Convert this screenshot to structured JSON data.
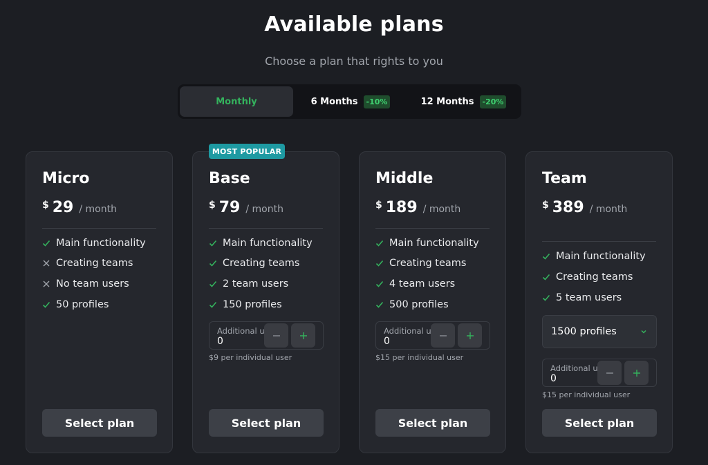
{
  "header": {
    "title": "Available plans",
    "subtitle": "Choose a plan that rights to you"
  },
  "billing": {
    "options": [
      {
        "label": "Monthly",
        "discount": "",
        "active": true
      },
      {
        "label": "6 Months",
        "discount": "-10%",
        "active": false
      },
      {
        "label": "12 Months",
        "discount": "-20%",
        "active": false
      }
    ]
  },
  "badge": "MOST POPULAR",
  "plans": [
    {
      "name": "Micro",
      "currency": "$",
      "price": "29",
      "period": "/ month",
      "features": [
        {
          "text": "Main functionality",
          "included": true
        },
        {
          "text": "Creating teams",
          "included": false
        },
        {
          "text": "No team users",
          "included": false
        },
        {
          "text": "50 profiles",
          "included": true
        }
      ],
      "button": "Select plan"
    },
    {
      "name": "Base",
      "currency": "$",
      "price": "79",
      "period": "/ month",
      "features": [
        {
          "text": "Main functionality",
          "included": true
        },
        {
          "text": "Creating teams",
          "included": true
        },
        {
          "text": "2 team users",
          "included": true
        },
        {
          "text": "150 profiles",
          "included": true
        }
      ],
      "additional": {
        "label": "Additional users",
        "value": "0",
        "note": "$9 per individual user"
      },
      "button": "Select plan"
    },
    {
      "name": "Middle",
      "currency": "$",
      "price": "189",
      "period": "/ month",
      "features": [
        {
          "text": "Main functionality",
          "included": true
        },
        {
          "text": "Creating teams",
          "included": true
        },
        {
          "text": "4 team users",
          "included": true
        },
        {
          "text": "500 profiles",
          "included": true
        }
      ],
      "additional": {
        "label": "Additional users",
        "value": "0",
        "note": "$15 per individual user"
      },
      "button": "Select plan"
    },
    {
      "name": "Team",
      "currency": "$",
      "price": "389",
      "period": "/ month",
      "features": [
        {
          "text": "Main functionality",
          "included": true
        },
        {
          "text": "Creating teams",
          "included": true
        },
        {
          "text": "5 team users",
          "included": true
        }
      ],
      "profiles_select": "1500 profiles",
      "additional": {
        "label": "Additional users",
        "value": "0",
        "note": "$15 per individual user"
      },
      "button": "Select plan"
    }
  ],
  "colors": {
    "background": "#1c1e23",
    "card": "#25272d",
    "accent_green": "#34b25d",
    "badge": "#1e9aa2",
    "button": "#3d4047"
  },
  "icons": {
    "included": "check-icon",
    "excluded": "cross-icon",
    "stepper_minus": "minus-icon",
    "stepper_plus": "plus-icon",
    "dropdown": "chevron-down-icon"
  }
}
